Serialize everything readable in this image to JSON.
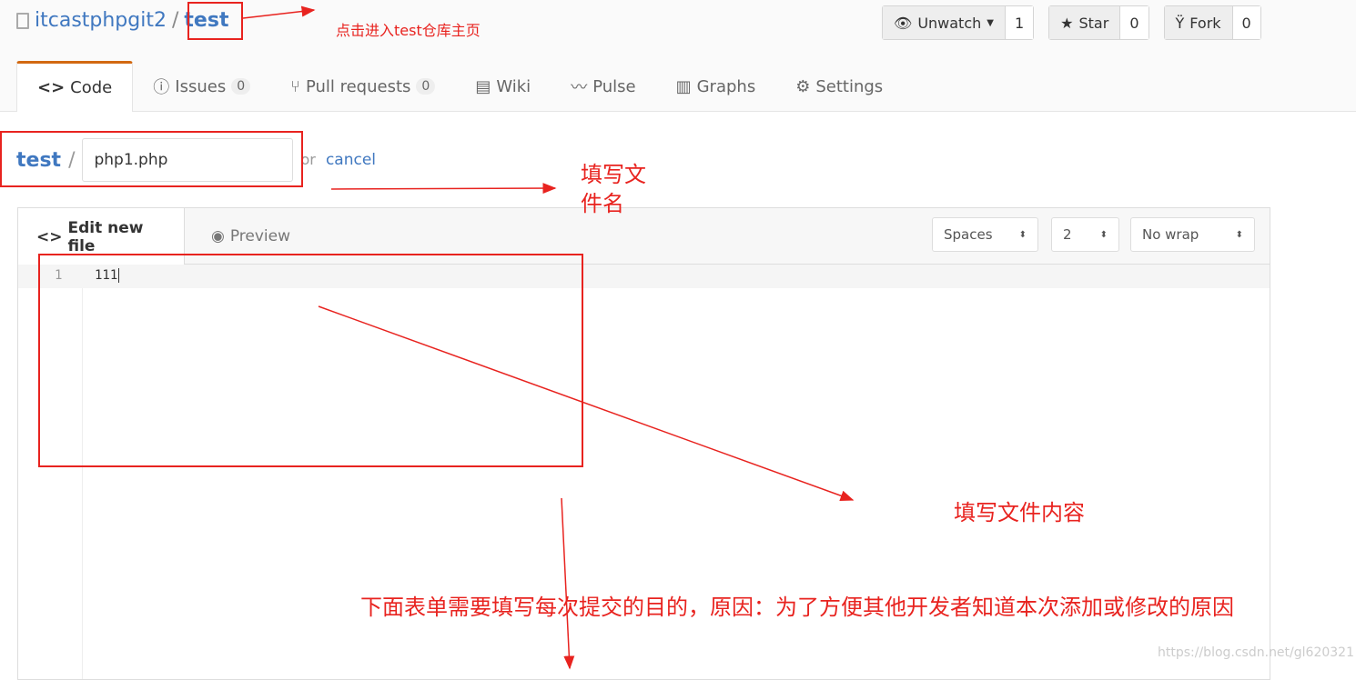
{
  "header": {
    "owner": "itcastphpgit2",
    "separator": "/",
    "repo": "test",
    "watch": {
      "label": "Unwatch",
      "count": "1"
    },
    "star": {
      "label": "Star",
      "count": "0"
    },
    "fork": {
      "label": "Fork",
      "count": "0"
    }
  },
  "tabs": [
    {
      "label": "Code",
      "icon": "code-icon"
    },
    {
      "label": "Issues",
      "count": "0",
      "icon": "issue-icon"
    },
    {
      "label": "Pull requests",
      "count": "0",
      "icon": "pull-request-icon"
    },
    {
      "label": "Wiki",
      "icon": "book-icon"
    },
    {
      "label": "Pulse",
      "icon": "pulse-icon"
    },
    {
      "label": "Graphs",
      "icon": "graph-icon"
    },
    {
      "label": "Settings",
      "icon": "gear-icon"
    }
  ],
  "path": {
    "repo": "test",
    "separator": "/",
    "filename": "php1.php",
    "or": "or",
    "cancel": "cancel"
  },
  "editor": {
    "tab_edit": "Edit new file",
    "tab_preview": "Preview",
    "indent_mode": "Spaces",
    "indent_size": "2",
    "wrap": "No wrap",
    "lines": [
      {
        "number": "1",
        "text": "111"
      }
    ]
  },
  "annotations": {
    "repo_home": "点击进入test仓库主页",
    "filename": "填写文件名",
    "content": "填写文件内容",
    "commit": "下面表单需要填写每次提交的目的，原因：为了方便其他开发者知道本次添加或修改的原因"
  },
  "watermark": "https://blog.csdn.net/gl620321",
  "colors": {
    "accent": "#4078c0",
    "active_tab": "#d26911",
    "annotation": "#e8231f"
  }
}
